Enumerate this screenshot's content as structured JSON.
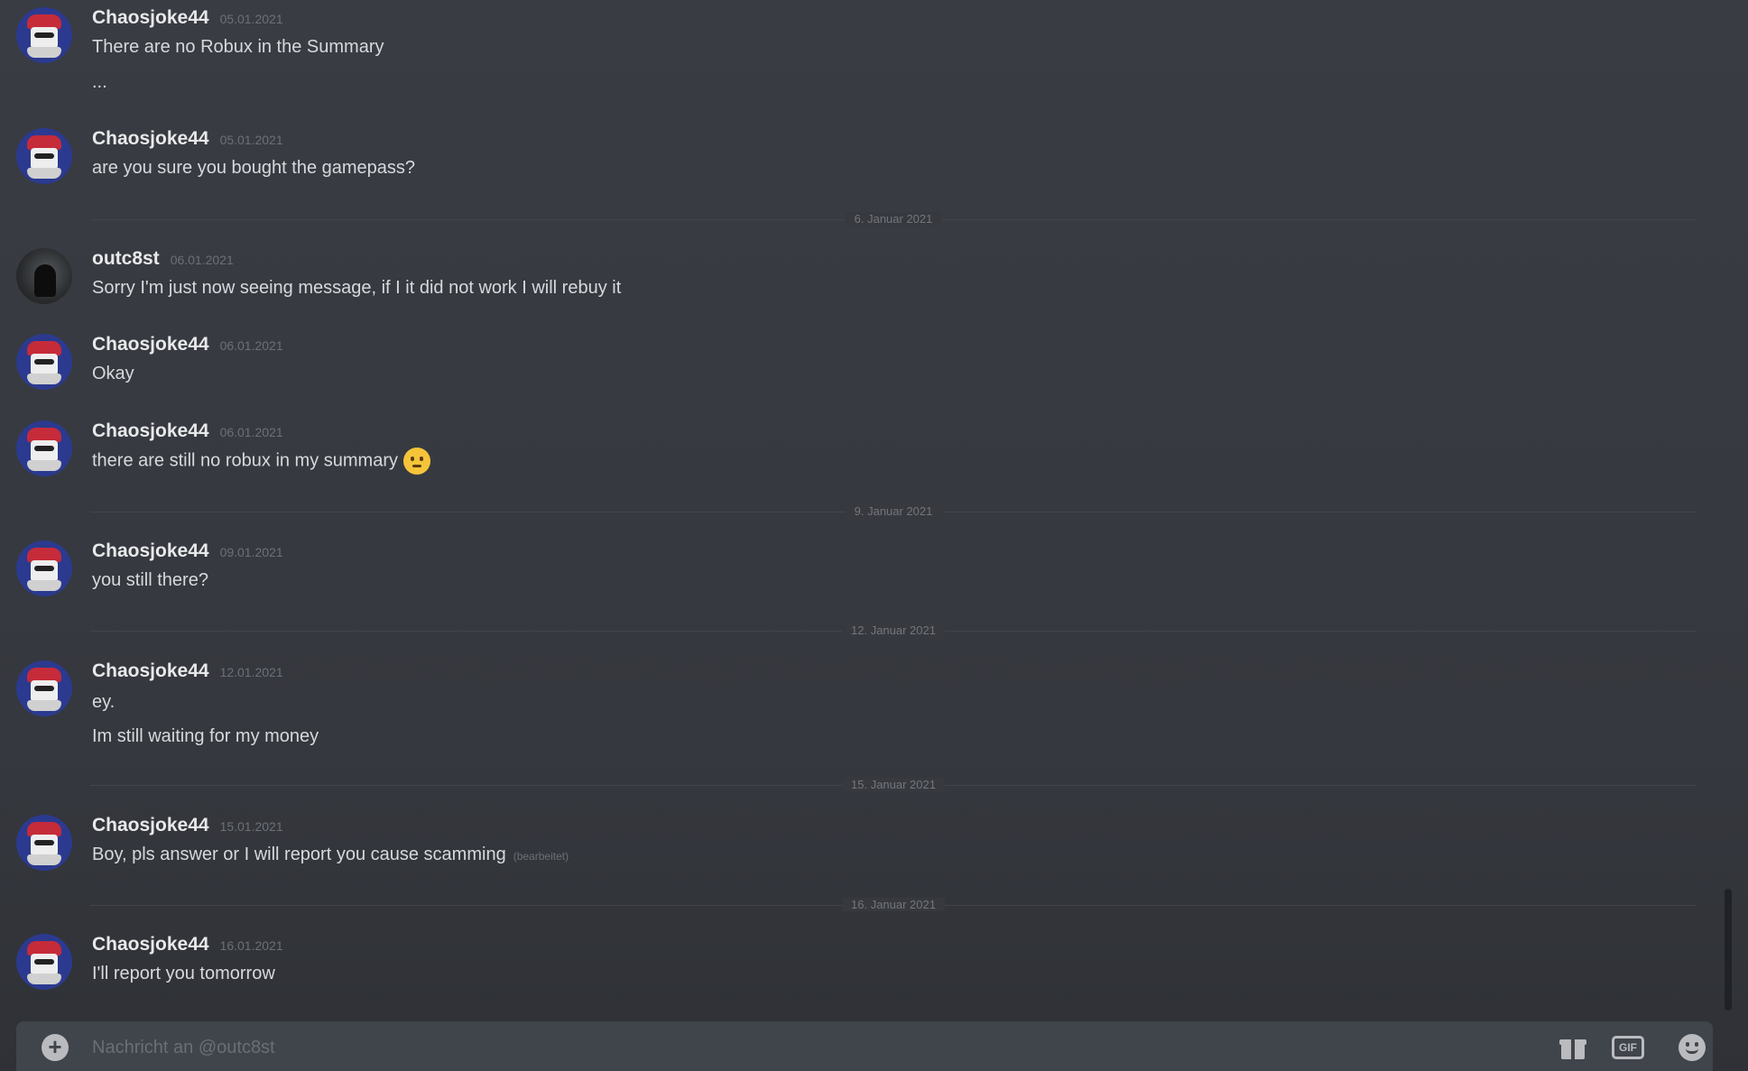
{
  "messages": [
    {
      "author": "Chaosjoke44",
      "time": "05.01.2021",
      "lines": [
        "There are no Robux in the Summary",
        "..."
      ]
    },
    {
      "author": "Chaosjoke44",
      "time": "05.01.2021",
      "lines": [
        "are you sure you bought the gamepass?"
      ]
    },
    {
      "author": "outc8st",
      "time": "06.01.2021",
      "lines": [
        "Sorry I'm just now seeing message, if I it did not work I will rebuy it"
      ]
    },
    {
      "author": "Chaosjoke44",
      "time": "06.01.2021",
      "lines": [
        "Okay"
      ]
    },
    {
      "author": "Chaosjoke44",
      "time": "06.01.2021",
      "lines": [
        "there are still no robux in my summary"
      ],
      "emoji": "slightly-smiling-face"
    },
    {
      "author": "Chaosjoke44",
      "time": "09.01.2021",
      "lines": [
        "you still there?"
      ]
    },
    {
      "author": "Chaosjoke44",
      "time": "12.01.2021",
      "lines": [
        "ey.",
        "Im still waiting for my money"
      ]
    },
    {
      "author": "Chaosjoke44",
      "time": "15.01.2021",
      "lines": [
        "Boy, pls answer or I will report you cause scamming"
      ],
      "edited": "(bearbeitet)"
    },
    {
      "author": "Chaosjoke44",
      "time": "16.01.2021",
      "lines": [
        "I'll report you tomorrow"
      ]
    }
  ],
  "dividers": [
    "6. Januar 2021",
    "9. Januar 2021",
    "12. Januar 2021",
    "15. Januar 2021",
    "16. Januar 2021"
  ],
  "composer": {
    "placeholder": "Nachricht an @outc8st",
    "gif_label": "GIF"
  },
  "icons": {
    "attach": "plus-circle-icon",
    "gift": "gift-icon",
    "gif": "gif-icon",
    "emoji": "smile-icon"
  }
}
